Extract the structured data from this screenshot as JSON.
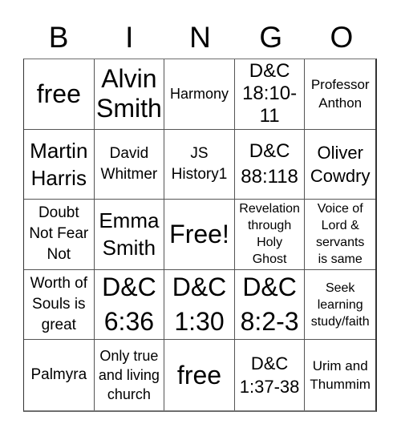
{
  "header": {
    "letters": [
      "B",
      "I",
      "N",
      "G",
      "O"
    ]
  },
  "board": {
    "rows": [
      [
        "free",
        "Alvin\nSmith",
        "Harmony",
        "D&C\n18:10-\n11",
        "Professor\nAnthon"
      ],
      [
        "Martin\nHarris",
        "David\nWhitmer",
        "JS\nHistory1",
        "D&C\n88:118",
        "Oliver\nCowdry"
      ],
      [
        "Doubt\nNot Fear\nNot",
        "Emma\nSmith",
        "Free!",
        "Revelation\nthrough\nHoly\nGhost",
        "Voice of\nLord &\nservants\nis same"
      ],
      [
        "Worth of\nSouls is\ngreat",
        "D&C\n6:36",
        "D&C\n1:30",
        "D&C\n8:2-3",
        "Seek\nlearning\nstudy/faith"
      ],
      [
        "Palmyra",
        "Only true\nand living\nchurch",
        "free",
        "D&C\n1:37-38",
        "Urim and\nThummim"
      ]
    ]
  },
  "colors": {
    "text": "#000000",
    "grid_line": "#555555",
    "background": "#ffffff"
  }
}
